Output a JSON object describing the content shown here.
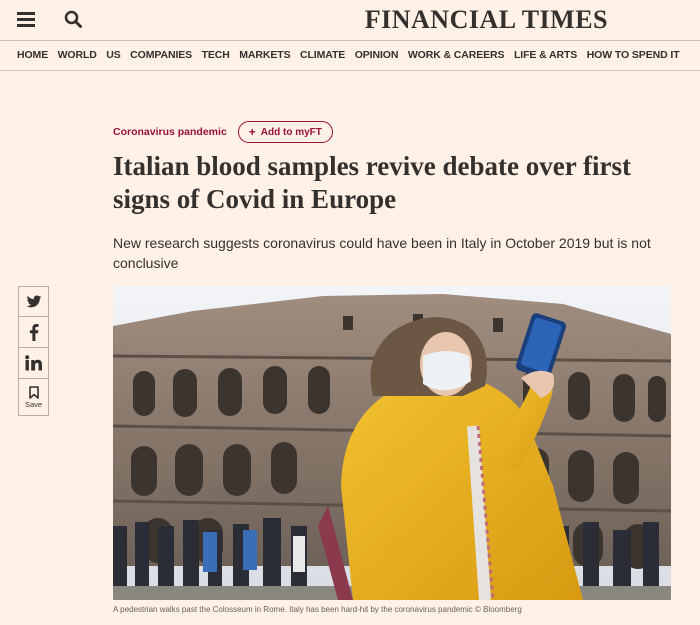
{
  "header": {
    "brand": "FINANCIAL TIMES"
  },
  "nav": [
    "HOME",
    "WORLD",
    "US",
    "COMPANIES",
    "TECH",
    "MARKETS",
    "CLIMATE",
    "OPINION",
    "WORK & CAREERS",
    "LIFE & ARTS",
    "HOW TO SPEND IT"
  ],
  "article": {
    "topic": "Coronavirus pandemic",
    "add_myft": "Add to myFT",
    "headline": "Italian blood samples revive debate over first signs of Covid in Europe",
    "standfirst": "New research suggests coronavirus could have been in Italy in October 2019 but is not conclusive",
    "caption": "A pedestrian walks past the Colosseum in Rome. Italy has been hard-hit by the coronavirus pandemic © Bloomberg"
  },
  "share": {
    "save_label": "Save"
  },
  "icons": [
    "menu-icon",
    "search-icon",
    "twitter-icon",
    "facebook-icon",
    "linkedin-icon",
    "bookmark-icon"
  ],
  "colors": {
    "background": "#fff1e5",
    "claret": "#990f3d",
    "text": "#33302e"
  }
}
